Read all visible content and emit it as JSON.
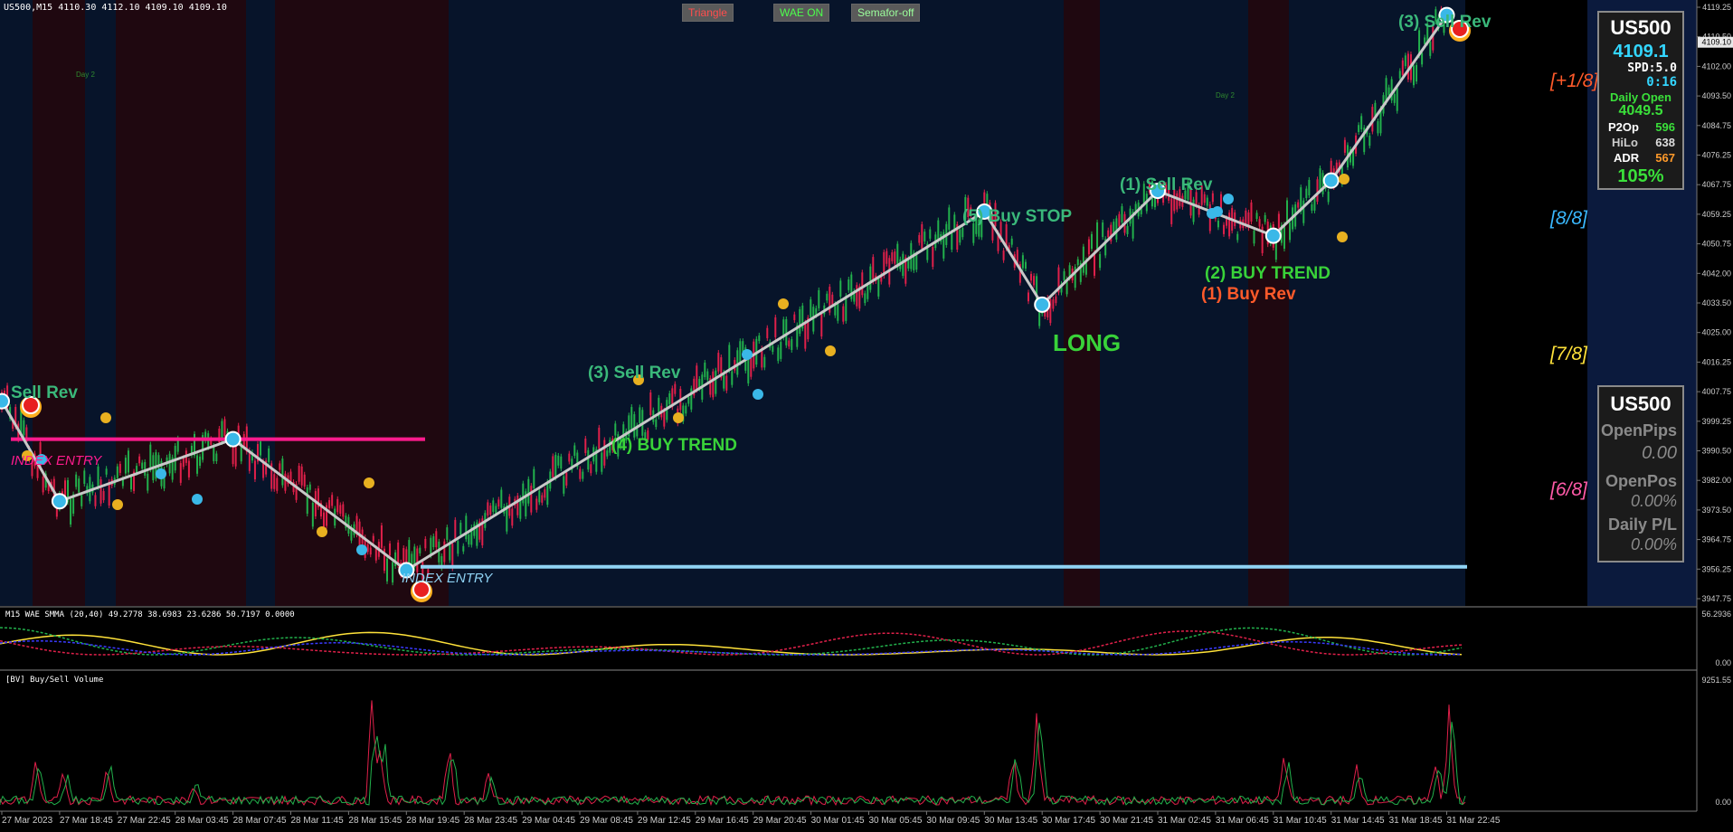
{
  "symbol_header": "US500,M15  4110.30 4112.10 4109.10 4109.10",
  "toolbar": {
    "triangle": "Triangle",
    "wae": "WAE ON",
    "semafor": "Semafor-off"
  },
  "colors": {
    "bg_dark": "#000000",
    "bg_blue": "#07142a",
    "bg_red": "#1f0810",
    "bull": "#22b14c",
    "bear": "#e0204a",
    "zigzag": "#c8c8c8",
    "magenta_line": "#ff1b8d",
    "cyan_line": "#8fd3f4"
  },
  "price_axis": {
    "ticks": [
      "4119.25",
      "4110.50",
      "4102.00",
      "4093.50",
      "4084.75",
      "4076.25",
      "4067.75",
      "4059.25",
      "4050.75",
      "4042.00",
      "4033.50",
      "4025.00",
      "4016.25",
      "4007.75",
      "3999.25",
      "3990.50",
      "3982.00",
      "3973.50",
      "3964.75",
      "3956.25",
      "3947.75"
    ],
    "current_price_label": "4109.10"
  },
  "time_axis": [
    "27 Mar 2023",
    "27 Mar 18:45",
    "27 Mar 22:45",
    "28 Mar 03:45",
    "28 Mar 07:45",
    "28 Mar 11:45",
    "28 Mar 15:45",
    "28 Mar 19:45",
    "28 Mar 23:45",
    "29 Mar 04:45",
    "29 Mar 08:45",
    "29 Mar 12:45",
    "29 Mar 16:45",
    "29 Mar 20:45",
    "30 Mar 01:45",
    "30 Mar 05:45",
    "30 Mar 09:45",
    "30 Mar 13:45",
    "30 Mar 17:45",
    "30 Mar 21:45",
    "31 Mar 02:45",
    "31 Mar 06:45",
    "31 Mar 10:45",
    "31 Mar 14:45",
    "31 Mar 18:45",
    "31 Mar 22:45"
  ],
  "murrey_levels": [
    {
      "label": "[+1/8]",
      "color": "#ff5a2a"
    },
    {
      "label": "[8/8]",
      "color": "#3ab8ff"
    },
    {
      "label": "[7/8]",
      "color": "#ffe23a"
    },
    {
      "label": "[6/8]",
      "color": "#ff5aa8"
    }
  ],
  "annotations": {
    "sell_rev_left": "Sell Rev",
    "index_entry_top": "INDEX ENTRY",
    "index_entry_bottom": "INDEX ENTRY",
    "sell_rev_3_mid": "(3) Sell Rev",
    "buy_trend_4": "(4) BUY TREND",
    "buy_stop_5": "(5) Buy STOP",
    "long": "LONG",
    "sell_rev_1": "(1) Sell Rev",
    "buy_trend_2": "(2) BUY TREND",
    "buy_rev_1": "(1) Buy Rev",
    "sell_rev_3_top": "(3) Sell Rev",
    "day_small": "Day 2"
  },
  "panel_top": {
    "symbol": "US500",
    "price": "4109.1",
    "spread": "SPD:5.0",
    "timer": "0:16",
    "daily_open_label": "Daily Open",
    "daily_open_value": "4049.5",
    "p2op_label": "P2Op",
    "p2op_value": "596",
    "hilo_label": "HiLo",
    "hilo_value": "638",
    "adr_label": "ADR",
    "adr_value": "567",
    "adr_pct": "105%"
  },
  "panel_bottom": {
    "symbol": "US500",
    "open_pips_label": "OpenPips",
    "open_pips_value": "0.00",
    "open_pos_label": "OpenPos",
    "open_pos_value": "0.00%",
    "daily_pl_label": "Daily P/L",
    "daily_pl_value": "0.00%"
  },
  "wae_header": "M15  WAE  SMMA (20,40) 49.2778 38.6983 23.6286 50.7197 0.0000",
  "wae_axis": {
    "top": "56.2936",
    "bottom": "0.00"
  },
  "vol_header": "[BV] Buy/Sell Volume",
  "vol_axis": {
    "top": "9251.55",
    "bottom": "0.00"
  },
  "chart_data": {
    "type": "line",
    "title": "",
    "series": [
      {
        "name": "",
        "x": [
          "27 Mar 2023",
          "27 Mar 18:45",
          "28 Mar 07:45",
          "28 Mar 19:45",
          "30 Mar 13:45",
          "30 Mar 17:45",
          "31 Mar 02:45",
          "31 Mar 10:45",
          "31 Mar 14:45",
          "31 Mar 22:45"
        ],
        "values": [
          4005,
          3976,
          3994,
          3956,
          4060,
          4033,
          4066,
          4053,
          4069,
          4117
        ]
      }
    ],
    "ylim": [
      3947.75,
      4119.25
    ],
    "levels": [
      {
        "label": "INDEX ENTRY",
        "value": 3994
      },
      {
        "label": "INDEX ENTRY",
        "value": 3957
      }
    ]
  }
}
